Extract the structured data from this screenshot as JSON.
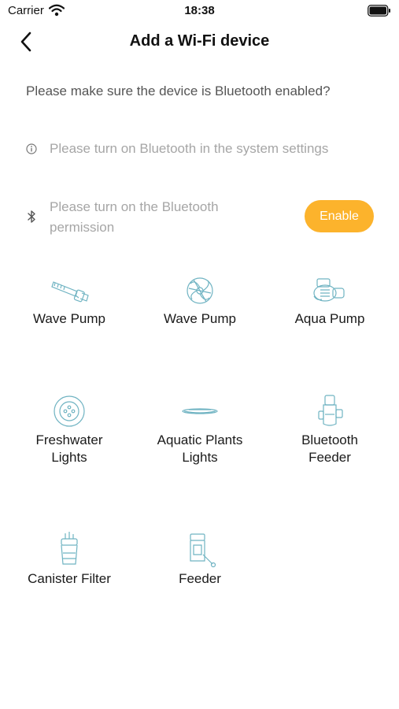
{
  "status_bar": {
    "carrier": "Carrier",
    "time": "18:38"
  },
  "header": {
    "title": "Add a Wi-Fi device"
  },
  "question": "Please make sure the device is Bluetooth enabled?",
  "hints": {
    "system_settings": "Please turn on Bluetooth in the system settings",
    "permission_line1": "Please turn on the Bluetooth",
    "permission_line2": "permission",
    "enable_label": "Enable"
  },
  "colors": {
    "accent": "#fcb32c",
    "icon_line": "#6fb3c2",
    "muted_text": "#a6a6a6"
  },
  "devices": [
    {
      "line1": "Wave Pump",
      "line2": "",
      "icon": "wave-pump-icon"
    },
    {
      "line1": "Wave Pump",
      "line2": "",
      "icon": "propeller-pump-icon"
    },
    {
      "line1": "Aqua Pump",
      "line2": "",
      "icon": "aqua-pump-icon"
    },
    {
      "line1": "Freshwater",
      "line2": "Lights",
      "icon": "round-light-icon"
    },
    {
      "line1": "Aquatic Plants",
      "line2": "Lights",
      "icon": "flat-light-icon"
    },
    {
      "line1": "Bluetooth",
      "line2": "Feeder",
      "icon": "bluetooth-feeder-icon"
    },
    {
      "line1": "Canister Filter",
      "line2": "",
      "icon": "canister-filter-icon"
    },
    {
      "line1": "Feeder",
      "line2": "",
      "icon": "feeder-icon"
    }
  ]
}
